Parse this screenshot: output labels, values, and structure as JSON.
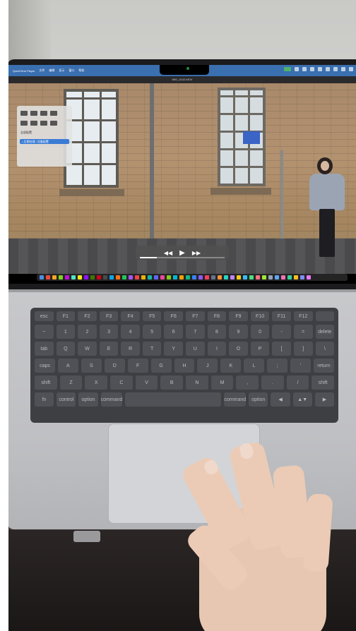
{
  "menubar": {
    "app_name": "QuickTime Player",
    "items": [
      "文件",
      "编辑",
      "显示",
      "窗口",
      "帮助"
    ]
  },
  "window_title": "IMG_0142.MOV",
  "side_panel": {
    "label": "全部配置",
    "selected": "• 后期处理 / 设备配置"
  },
  "keyboard": {
    "row1": [
      "esc",
      "F1",
      "F2",
      "F3",
      "F4",
      "F5",
      "F6",
      "F7",
      "F8",
      "F9",
      "F10",
      "F11",
      "F12",
      ""
    ],
    "row2": [
      "~",
      "1",
      "2",
      "3",
      "4",
      "5",
      "6",
      "7",
      "8",
      "9",
      "0",
      "-",
      "=",
      "delete"
    ],
    "row3": [
      "tab",
      "Q",
      "W",
      "E",
      "R",
      "T",
      "Y",
      "U",
      "I",
      "O",
      "P",
      "[",
      "]",
      "\\"
    ],
    "row4": [
      "caps",
      "A",
      "S",
      "D",
      "F",
      "G",
      "H",
      "J",
      "K",
      "L",
      ";",
      "'",
      "return"
    ],
    "row5": [
      "shift",
      "Z",
      "X",
      "C",
      "V",
      "B",
      "N",
      "M",
      ",",
      ".",
      "/",
      "shift"
    ],
    "row6": [
      "fn",
      "control",
      "option",
      "command",
      "",
      "command",
      "option",
      "◀",
      "▲▼",
      "▶"
    ]
  },
  "controls": {
    "rewind": "◀◀",
    "play": "▶",
    "forward": "▶▶",
    "progress": 0.2
  }
}
